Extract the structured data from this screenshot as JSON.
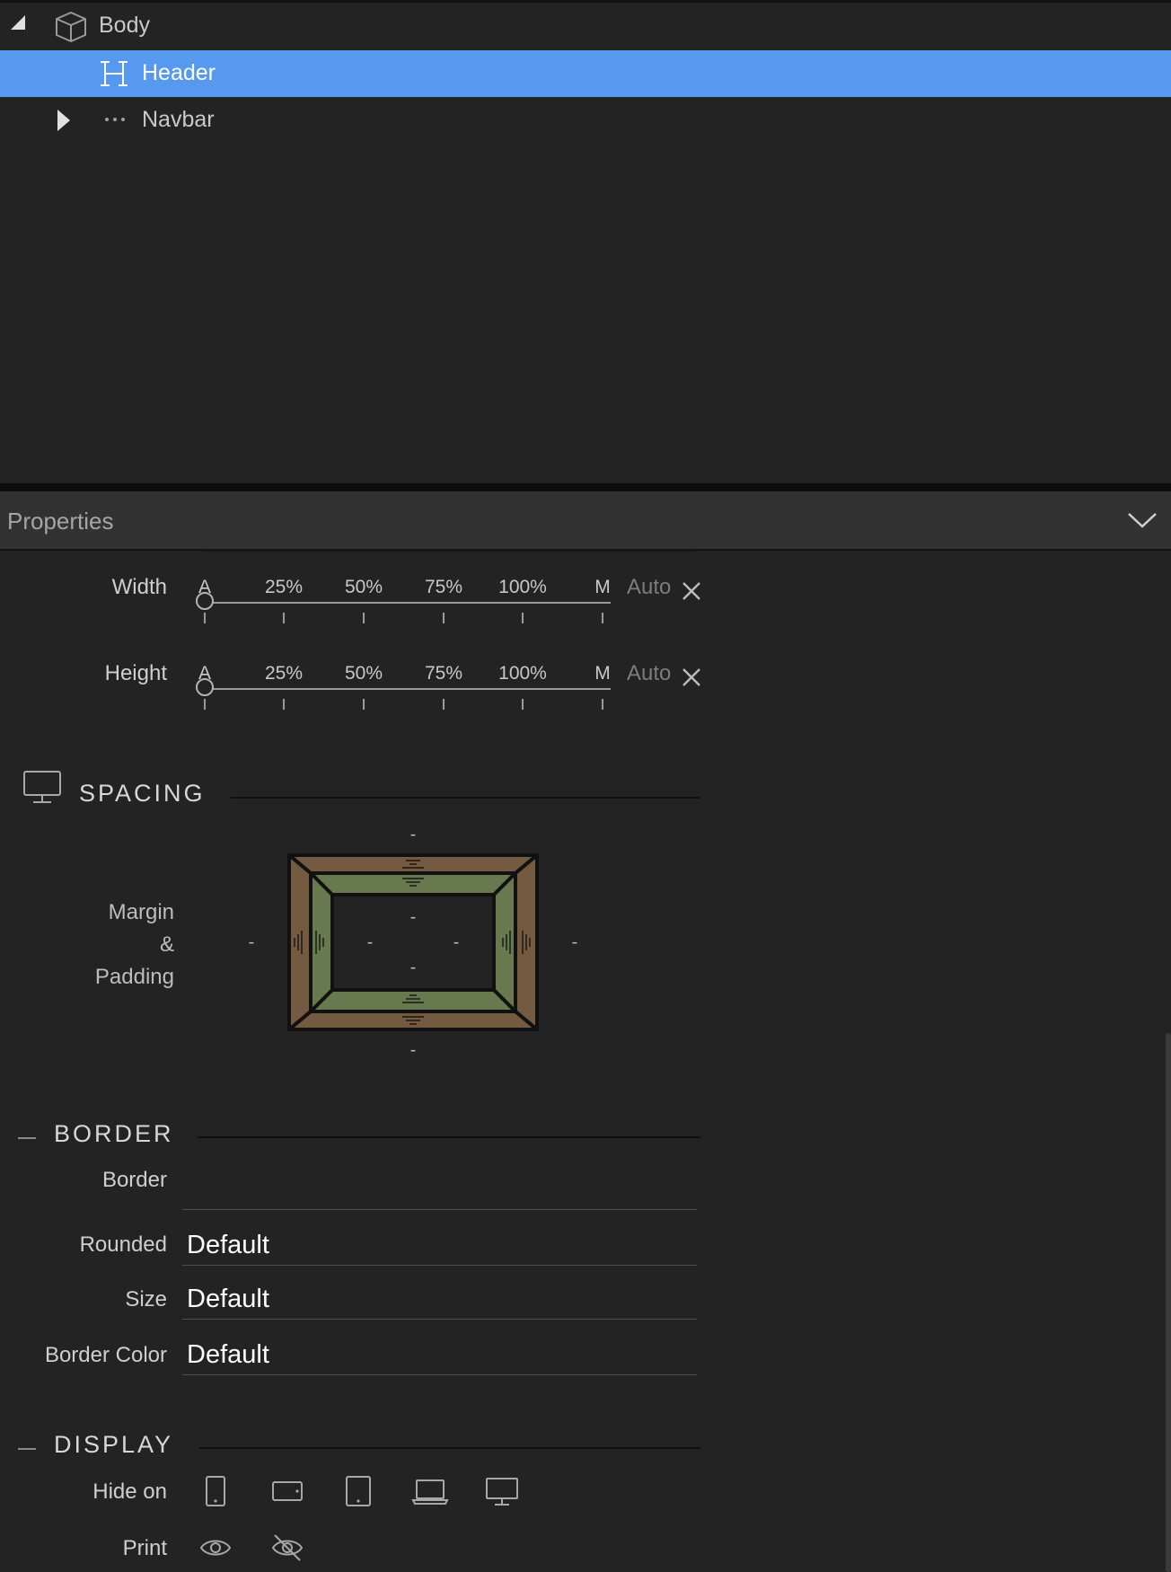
{
  "tree": {
    "items": [
      {
        "label": "Body",
        "icon": "cube-icon",
        "expanded": true
      },
      {
        "label": "Header",
        "icon": "heading-icon",
        "selected": true
      },
      {
        "label": "Navbar",
        "icon": "more-dots-icon",
        "expanded": false
      }
    ]
  },
  "properties": {
    "title": "Properties",
    "collapse_icon": "chevron-down-icon"
  },
  "sizing": {
    "width": {
      "label": "Width",
      "ticks": [
        "A",
        "25%",
        "50%",
        "75%",
        "100%",
        "M"
      ],
      "value": "Auto"
    },
    "height": {
      "label": "Height",
      "ticks": [
        "A",
        "25%",
        "50%",
        "75%",
        "100%",
        "M"
      ],
      "value": "Auto"
    }
  },
  "spacing": {
    "title": "SPACING",
    "device_icon": "desktop-icon",
    "label_line1": "Margin",
    "label_line2": "&",
    "label_line3": "Padding",
    "margin": {
      "top": "-",
      "right": "-",
      "bottom": "-",
      "left": "-"
    },
    "padding": {
      "top": "-",
      "right": "-",
      "bottom": "-",
      "left": "-"
    },
    "colors": {
      "margin": "#735a41",
      "padding": "#68784f"
    }
  },
  "border": {
    "title": "BORDER",
    "border_label": "Border",
    "border_value": "",
    "rounded_label": "Rounded",
    "rounded_value": "Default",
    "size_label": "Size",
    "size_value": "Default",
    "color_label": "Border Color",
    "color_value": "Default"
  },
  "display": {
    "title": "DISPLAY",
    "hide_on_label": "Hide on",
    "hide_on_icons": [
      "phone-portrait-icon",
      "phone-landscape-icon",
      "tablet-icon",
      "laptop-icon",
      "desktop-icon"
    ],
    "print_label": "Print",
    "print_icons": [
      "eye-icon",
      "eye-off-icon"
    ]
  },
  "colors": {
    "selection": "#5699ef",
    "background": "#232323"
  }
}
